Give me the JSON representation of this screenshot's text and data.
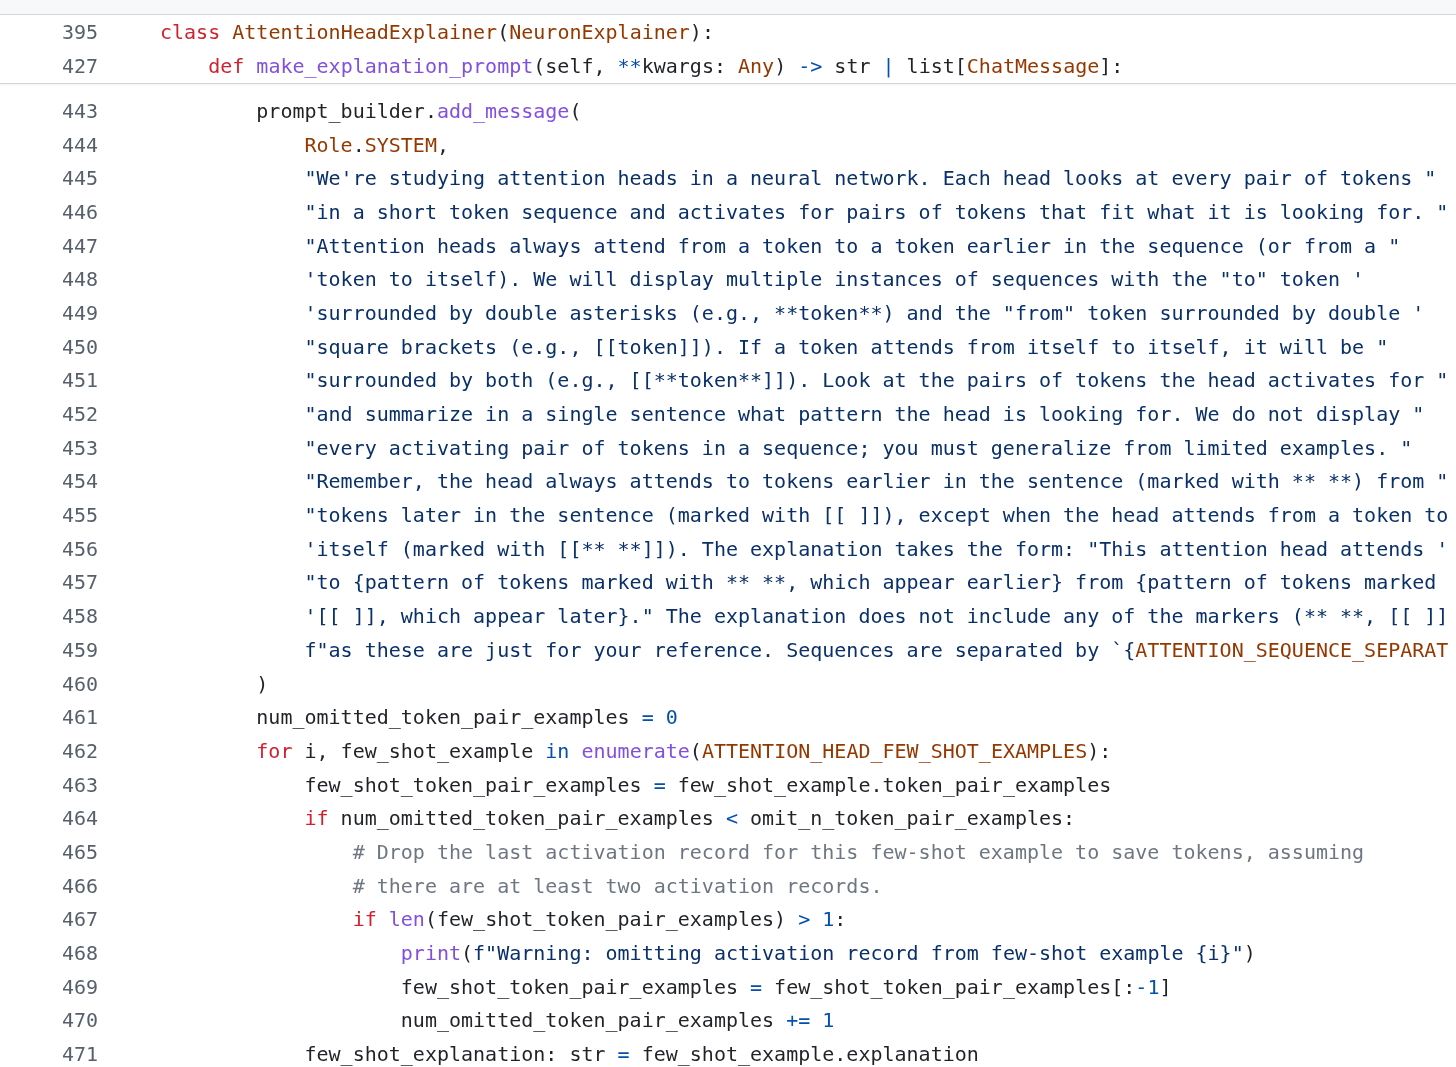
{
  "sticky_header": {
    "lines": [
      {
        "number": "395",
        "tokens": [
          {
            "kind": "keyword",
            "text": "class"
          },
          {
            "kind": "class",
            "text": " AttentionHeadExplainer"
          },
          {
            "kind": "plain",
            "text": "("
          },
          {
            "kind": "class",
            "text": "NeuronExplainer"
          },
          {
            "kind": "plain",
            "text": "):"
          }
        ]
      },
      {
        "number": "427",
        "tokens": [
          {
            "kind": "keyword",
            "text": "    def"
          },
          {
            "kind": "function",
            "text": " make_explanation_prompt"
          },
          {
            "kind": "plain",
            "text": "(self, "
          },
          {
            "kind": "operator",
            "text": "**"
          },
          {
            "kind": "plain",
            "text": "kwargs: "
          },
          {
            "kind": "class",
            "text": "Any"
          },
          {
            "kind": "plain",
            "text": ") "
          },
          {
            "kind": "operator",
            "text": "->"
          },
          {
            "kind": "plain",
            "text": " str "
          },
          {
            "kind": "operator",
            "text": "|"
          },
          {
            "kind": "plain",
            "text": " list["
          },
          {
            "kind": "class",
            "text": "ChatMessage"
          },
          {
            "kind": "plain",
            "text": "]:"
          }
        ]
      }
    ]
  },
  "code": {
    "lines": [
      {
        "number": "443",
        "tokens": [
          {
            "kind": "plain",
            "text": "        prompt_builder."
          },
          {
            "kind": "function",
            "text": "add_message"
          },
          {
            "kind": "plain",
            "text": "("
          }
        ]
      },
      {
        "number": "444",
        "tokens": [
          {
            "kind": "class",
            "text": "            Role"
          },
          {
            "kind": "plain",
            "text": "."
          },
          {
            "kind": "class",
            "text": "SYSTEM"
          },
          {
            "kind": "plain",
            "text": ","
          }
        ]
      },
      {
        "number": "445",
        "tokens": [
          {
            "kind": "string",
            "text": "            \"We're studying attention heads in a neural network. Each head looks at every pair of tokens \""
          }
        ]
      },
      {
        "number": "446",
        "tokens": [
          {
            "kind": "string",
            "text": "            \"in a short token sequence and activates for pairs of tokens that fit what it is looking for. \""
          }
        ]
      },
      {
        "number": "447",
        "tokens": [
          {
            "kind": "string",
            "text": "            \"Attention heads always attend from a token to a token earlier in the sequence (or from a \""
          }
        ]
      },
      {
        "number": "448",
        "tokens": [
          {
            "kind": "string",
            "text": "            'token to itself). We will display multiple instances of sequences with the \"to\" token '"
          }
        ]
      },
      {
        "number": "449",
        "tokens": [
          {
            "kind": "string",
            "text": "            'surrounded by double asterisks (e.g., **token**) and the \"from\" token surrounded by double '"
          }
        ]
      },
      {
        "number": "450",
        "tokens": [
          {
            "kind": "string",
            "text": "            \"square brackets (e.g., [[token]]). If a token attends from itself to itself, it will be \""
          }
        ]
      },
      {
        "number": "451",
        "tokens": [
          {
            "kind": "string",
            "text": "            \"surrounded by both (e.g., [[**token**]]). Look at the pairs of tokens the head activates for \""
          }
        ]
      },
      {
        "number": "452",
        "tokens": [
          {
            "kind": "string",
            "text": "            \"and summarize in a single sentence what pattern the head is looking for. We do not display \""
          }
        ]
      },
      {
        "number": "453",
        "tokens": [
          {
            "kind": "string",
            "text": "            \"every activating pair of tokens in a sequence; you must generalize from limited examples. \""
          }
        ]
      },
      {
        "number": "454",
        "tokens": [
          {
            "kind": "string",
            "text": "            \"Remember, the head always attends to tokens earlier in the sentence (marked with ** **) from \""
          }
        ]
      },
      {
        "number": "455",
        "tokens": [
          {
            "kind": "string",
            "text": "            \"tokens later in the sentence (marked with [[ ]]), except when the head attends from a token to"
          }
        ]
      },
      {
        "number": "456",
        "tokens": [
          {
            "kind": "string",
            "text": "            'itself (marked with [[** **]]). The explanation takes the form: \"This attention head attends '"
          }
        ]
      },
      {
        "number": "457",
        "tokens": [
          {
            "kind": "string",
            "text": "            \"to {pattern of tokens marked with ** **, which appear earlier} from {pattern of tokens marked"
          }
        ]
      },
      {
        "number": "458",
        "tokens": [
          {
            "kind": "string",
            "text": "            '[[ ]], which appear later}.\" The explanation does not include any of the markers (** **, [[ ]]"
          }
        ]
      },
      {
        "number": "459",
        "tokens": [
          {
            "kind": "string",
            "text": "            f\"as these are just for your reference. Sequences are separated by `{"
          },
          {
            "kind": "class",
            "text": "ATTENTION_SEQUENCE_SEPARAT"
          }
        ]
      },
      {
        "number": "460",
        "tokens": [
          {
            "kind": "plain",
            "text": "        )"
          }
        ]
      },
      {
        "number": "461",
        "tokens": [
          {
            "kind": "plain",
            "text": "        num_omitted_token_pair_examples "
          },
          {
            "kind": "operator",
            "text": "="
          },
          {
            "kind": "number",
            "text": " 0"
          }
        ]
      },
      {
        "number": "462",
        "tokens": [
          {
            "kind": "keyword",
            "text": "        for"
          },
          {
            "kind": "plain",
            "text": " i, few_shot_example "
          },
          {
            "kind": "operator",
            "text": "in"
          },
          {
            "kind": "function",
            "text": " enumerate"
          },
          {
            "kind": "plain",
            "text": "("
          },
          {
            "kind": "class",
            "text": "ATTENTION_HEAD_FEW_SHOT_EXAMPLES"
          },
          {
            "kind": "plain",
            "text": "):"
          }
        ]
      },
      {
        "number": "463",
        "tokens": [
          {
            "kind": "plain",
            "text": "            few_shot_token_pair_examples "
          },
          {
            "kind": "operator",
            "text": "="
          },
          {
            "kind": "plain",
            "text": " few_shot_example.token_pair_examples"
          }
        ]
      },
      {
        "number": "464",
        "tokens": [
          {
            "kind": "keyword",
            "text": "            if"
          },
          {
            "kind": "plain",
            "text": " num_omitted_token_pair_examples "
          },
          {
            "kind": "operator",
            "text": "<"
          },
          {
            "kind": "plain",
            "text": " omit_n_token_pair_examples:"
          }
        ]
      },
      {
        "number": "465",
        "tokens": [
          {
            "kind": "comment",
            "text": "                # Drop the last activation record for this few-shot example to save tokens, assuming"
          }
        ]
      },
      {
        "number": "466",
        "tokens": [
          {
            "kind": "comment",
            "text": "                # there are at least two activation records."
          }
        ]
      },
      {
        "number": "467",
        "tokens": [
          {
            "kind": "keyword",
            "text": "                if"
          },
          {
            "kind": "function",
            "text": " len"
          },
          {
            "kind": "plain",
            "text": "(few_shot_token_pair_examples) "
          },
          {
            "kind": "operator",
            "text": ">"
          },
          {
            "kind": "number",
            "text": " 1"
          },
          {
            "kind": "plain",
            "text": ":"
          }
        ]
      },
      {
        "number": "468",
        "tokens": [
          {
            "kind": "function",
            "text": "                    print"
          },
          {
            "kind": "plain",
            "text": "("
          },
          {
            "kind": "string",
            "text": "f\"Warning: omitting activation record from few-shot example {i}\""
          },
          {
            "kind": "plain",
            "text": ")"
          }
        ]
      },
      {
        "number": "469",
        "tokens": [
          {
            "kind": "plain",
            "text": "                    few_shot_token_pair_examples "
          },
          {
            "kind": "operator",
            "text": "="
          },
          {
            "kind": "plain",
            "text": " few_shot_token_pair_examples[:"
          },
          {
            "kind": "number",
            "text": "-1"
          },
          {
            "kind": "plain",
            "text": "]"
          }
        ]
      },
      {
        "number": "470",
        "tokens": [
          {
            "kind": "plain",
            "text": "                    num_omitted_token_pair_examples "
          },
          {
            "kind": "operator",
            "text": "+="
          },
          {
            "kind": "number",
            "text": " 1"
          }
        ]
      },
      {
        "number": "471",
        "tokens": [
          {
            "kind": "plain",
            "text": "            few_shot_explanation: str "
          },
          {
            "kind": "operator",
            "text": "="
          },
          {
            "kind": "plain",
            "text": " few_shot_example.explanation"
          }
        ]
      }
    ]
  }
}
